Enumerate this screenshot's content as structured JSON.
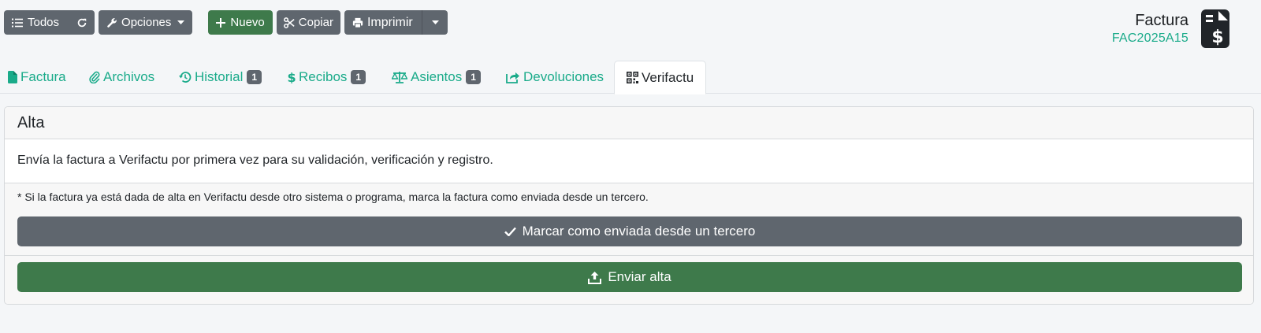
{
  "toolbar": {
    "all_label": "Todos",
    "options_label": "Opciones",
    "new_label": "Nuevo",
    "copy_label": "Copiar",
    "print_label": "Imprimir"
  },
  "header": {
    "title": "Factura",
    "code": "FAC2025A15"
  },
  "tabs": [
    {
      "label": "Factura",
      "badge": null,
      "icon": "file-icon"
    },
    {
      "label": "Archivos",
      "badge": null,
      "icon": "paperclip-icon"
    },
    {
      "label": "Historial",
      "badge": "1",
      "icon": "history-icon"
    },
    {
      "label": "Recibos",
      "badge": "1",
      "icon": "dollar-icon"
    },
    {
      "label": "Asientos",
      "badge": "1",
      "icon": "scale-icon"
    },
    {
      "label": "Devoluciones",
      "badge": null,
      "icon": "share-icon"
    },
    {
      "label": "Verifactu",
      "badge": null,
      "icon": "qrcode-icon",
      "active": true
    }
  ],
  "card": {
    "title": "Alta",
    "description": "Envía la factura a Verifactu por primera vez para su validación, verificación y registro.",
    "note": "* Si la factura ya está dada de alta en Verifactu desde otro sistema o programa, marca la factura como enviada desde un tercero.",
    "mark_sent_label": "Marcar como enviada desde un tercero",
    "send_label": "Enviar alta"
  },
  "colors": {
    "accent": "#1aab8a",
    "button_gray": "#5f666e",
    "button_green": "#3e7a4b"
  }
}
